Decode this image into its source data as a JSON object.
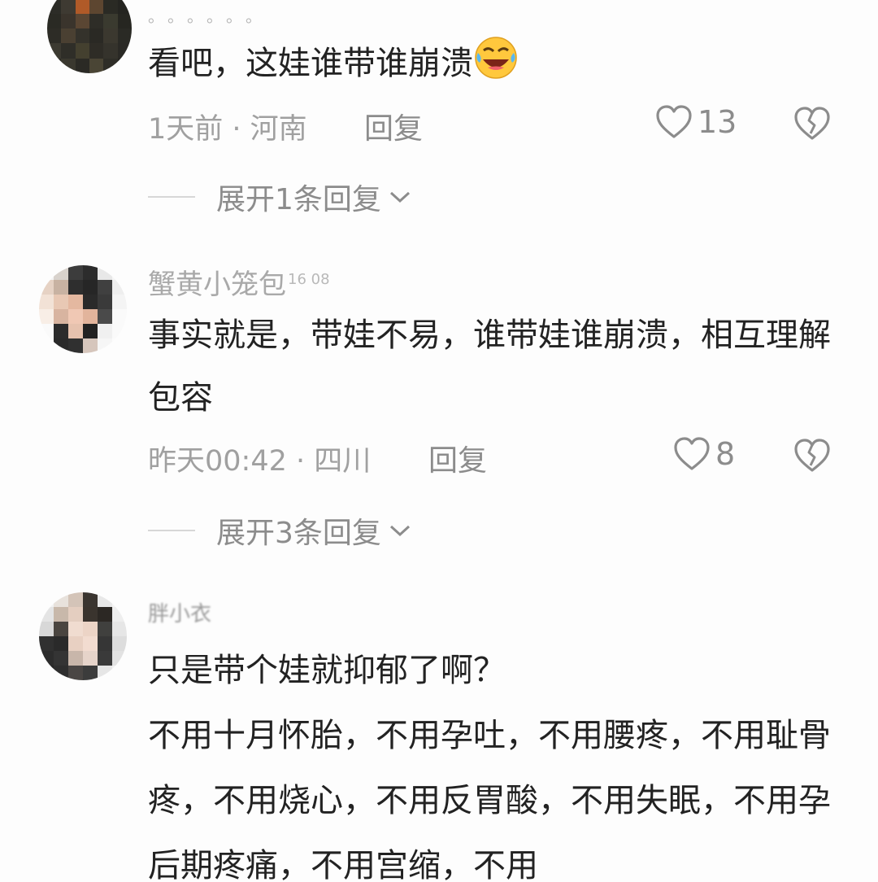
{
  "comments": [
    {
      "username": "。。。。。。",
      "text": "看吧，这娃谁带谁崩溃",
      "emoji": "laughing-face-emoji",
      "meta": "1天前 · 河南",
      "reply_label": "回复",
      "likes": "13",
      "expand_label": "展开1条回复"
    },
    {
      "username": "蟹黄小笼包",
      "username_suffix": "16 08",
      "text": "事实就是，带娃不易，谁带娃谁崩溃，相互理解包容",
      "meta": "昨天00:42 · 四川",
      "reply_label": "回复",
      "likes": "8",
      "expand_label": "展开3条回复"
    },
    {
      "username": "胖小衣",
      "text": "只是带个娃就抑郁了啊？\n不用十月怀胎，不用孕吐，不用腰疼，不用耻骨疼，不用烧心，不用反胃酸，不用失眠，不用孕后期疼痛，不用宫缩，不用"
    }
  ],
  "colors": {
    "text": "#222222",
    "meta": "#a0a0a0",
    "action": "#8c8c8c",
    "background": "#fdfdfd"
  }
}
